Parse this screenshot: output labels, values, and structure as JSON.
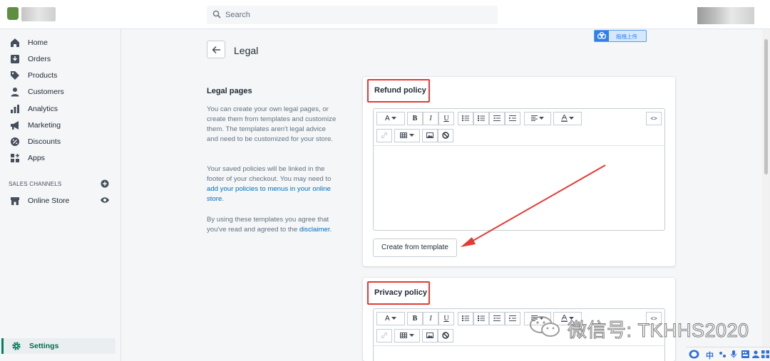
{
  "topbar": {
    "search_placeholder": "Search"
  },
  "sidebar": {
    "items": [
      {
        "label": "Home",
        "icon": "home-icon"
      },
      {
        "label": "Orders",
        "icon": "orders-icon"
      },
      {
        "label": "Products",
        "icon": "tag-icon"
      },
      {
        "label": "Customers",
        "icon": "person-icon"
      },
      {
        "label": "Analytics",
        "icon": "bar-chart-icon"
      },
      {
        "label": "Marketing",
        "icon": "megaphone-icon"
      },
      {
        "label": "Discounts",
        "icon": "discount-icon"
      },
      {
        "label": "Apps",
        "icon": "apps-icon"
      }
    ],
    "sales_channels_label": "SALES CHANNELS",
    "online_store_label": "Online Store",
    "settings_label": "Settings"
  },
  "header": {
    "title": "Legal",
    "upload_badge": "拖拽上传"
  },
  "description": {
    "title": "Legal pages",
    "para1": "You can create your own legal pages, or create them from templates and customize them. The templates aren't legal advice and need to be customized for your store.",
    "para2_prefix": "Your saved policies will be linked in the footer of your checkout. You may need to ",
    "para2_link": "add your policies to menus in your online store",
    "para2_suffix": ".",
    "para3_prefix": "By using these templates you agree that you've read and agreed to the ",
    "para3_link": "disclaimer",
    "para3_suffix": "."
  },
  "refund_card": {
    "title": "Refund policy",
    "template_button": "Create from template"
  },
  "privacy_card": {
    "title": "Privacy policy"
  },
  "toolbar": {
    "font_label": "A",
    "bold_label": "B",
    "italic_label": "I",
    "underline_label": "U",
    "html_label": "<>"
  },
  "watermark": {
    "text": "微信号: TKHHS2020"
  },
  "ime": {
    "lang": "中"
  },
  "colors": {
    "accent": "#008060",
    "link": "#006fbb",
    "annotation": "#e53935"
  }
}
